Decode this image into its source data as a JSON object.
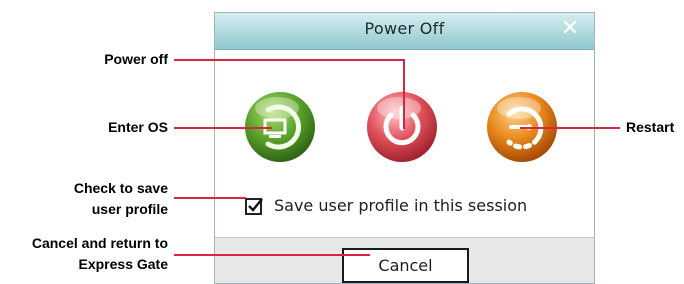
{
  "dialog": {
    "title": "Power Off",
    "close_icon": "close-icon",
    "buttons": {
      "enter_os": {
        "icon": "enter-os-icon",
        "color": "#5aa12b"
      },
      "power_off": {
        "icon": "power-icon",
        "color": "#d9404a"
      },
      "restart": {
        "icon": "restart-icon",
        "color": "#e07a10"
      }
    },
    "checkbox": {
      "label": "Save user profile in this session",
      "checked": true
    },
    "cancel_label": "Cancel"
  },
  "callouts": {
    "power_off": "Power off",
    "enter_os": "Enter OS",
    "restart": "Restart",
    "save_profile_line1": "Check to save",
    "save_profile_line2": "user profile",
    "cancel_line1": "Cancel and return to",
    "cancel_line2": "Express Gate"
  },
  "colors": {
    "leader_line": "#d7263d",
    "titlebar": "#8fc8cf"
  }
}
